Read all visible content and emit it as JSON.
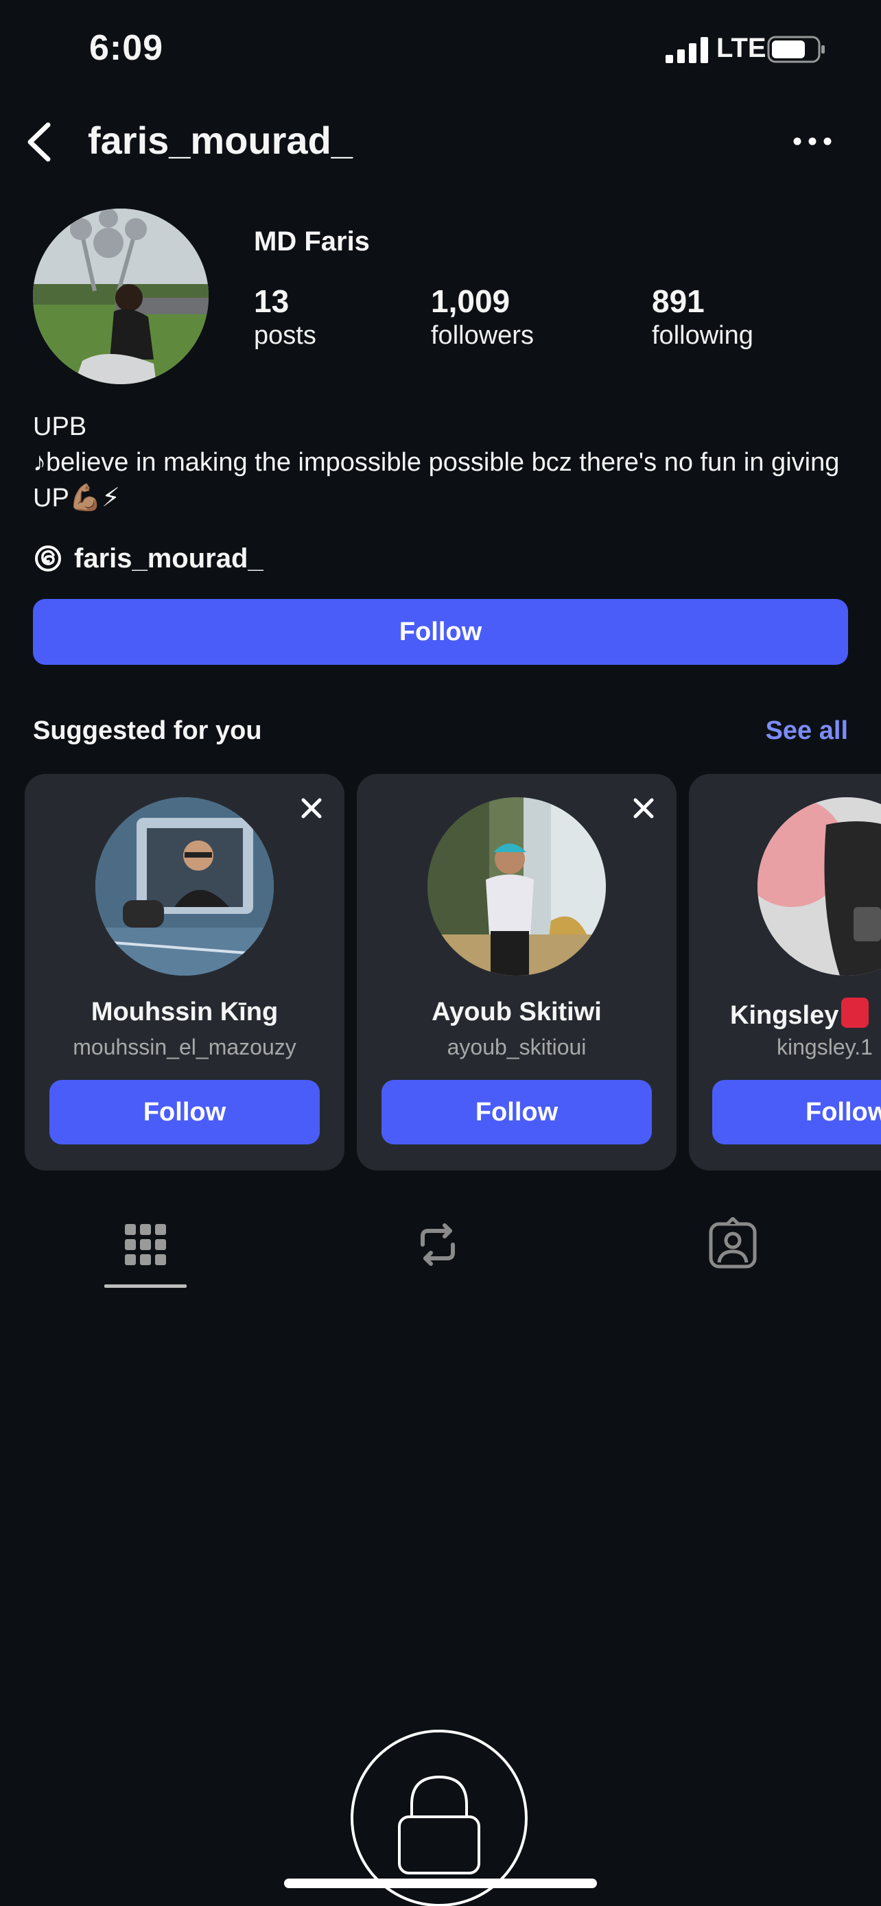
{
  "status_bar": {
    "time": "6:09",
    "network": "LTE"
  },
  "header": {
    "username": "faris_mourad_",
    "back_icon": "chevron-left-icon",
    "more_icon": "ellipsis-icon"
  },
  "profile": {
    "name": "MD Faris",
    "stats": [
      {
        "value": "13",
        "label": "posts"
      },
      {
        "value": "1,009",
        "label": "followers"
      },
      {
        "value": "891",
        "label": "following"
      }
    ],
    "bio_line1": "UPB",
    "bio_line2": "♪believe in making the impossible possible bcz there's no fun in giving UP💪🏽⚡",
    "threads_handle": "faris_mourad_",
    "follow_label": "Follow"
  },
  "suggested": {
    "title": "Suggested for you",
    "see_all": "See all",
    "cards": [
      {
        "name": "Mouhssin Kīng",
        "handle": "mouhssin_el_mazouzy",
        "follow": "Follow"
      },
      {
        "name": "Ayoub Skitiwi",
        "handle": "ayoub_skitioui",
        "follow": "Follow"
      },
      {
        "name": "Kingsley",
        "handle": "kingsley.1",
        "follow": "Follow"
      }
    ]
  },
  "tabs": {
    "icons": [
      "grid-icon",
      "repost-icon",
      "tagged-person-icon"
    ]
  },
  "colors": {
    "background": "#0c1014",
    "accent": "#4a5df9",
    "card": "#262a30",
    "link": "#7c8cf8"
  }
}
